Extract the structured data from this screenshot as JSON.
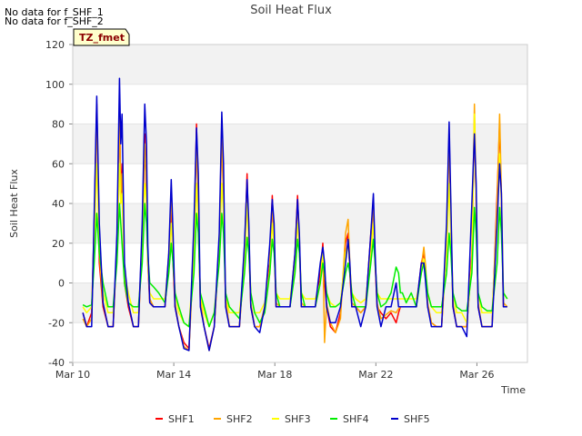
{
  "notices": [
    "No data for f_SHF_1",
    "No data for f_SHF_2"
  ],
  "tz_badge": "TZ_fmet",
  "chart_data": {
    "type": "line",
    "title": "Soil Heat Flux",
    "xlabel": "Time",
    "ylabel": "Soil Heat Flux",
    "ylim": [
      -40,
      120
    ],
    "yticks": [
      -40,
      -20,
      0,
      20,
      40,
      60,
      80,
      100,
      120
    ],
    "xlim": [
      "Mar 10",
      "Mar 28"
    ],
    "xticks": [
      "Mar 10",
      "Mar 14",
      "Mar 18",
      "Mar 22",
      "Mar 26"
    ],
    "grid": "horizontal bands",
    "legend_position": "bottom",
    "series": [
      {
        "name": "SHF1",
        "color": "#ff0000",
        "x": [
          10.4,
          10.55,
          10.75,
          10.85,
          10.95,
          11.05,
          11.2,
          11.4,
          11.6,
          11.75,
          11.85,
          11.9,
          11.95,
          12.05,
          12.2,
          12.4,
          12.6,
          12.75,
          12.85,
          12.92,
          12.97,
          13.05,
          13.2,
          13.4,
          13.65,
          13.8,
          13.9,
          13.97,
          14.05,
          14.2,
          14.4,
          14.6,
          14.8,
          14.9,
          14.97,
          15.05,
          15.2,
          15.4,
          15.6,
          15.8,
          15.9,
          15.97,
          16.05,
          16.2,
          16.4,
          16.6,
          16.8,
          16.9,
          16.97,
          17.05,
          17.2,
          17.4,
          17.6,
          17.8,
          17.9,
          17.97,
          18.05,
          18.2,
          18.4,
          18.6,
          18.8,
          18.9,
          18.97,
          19.05,
          19.2,
          19.4,
          19.6,
          19.8,
          19.9,
          19.97,
          20.05,
          20.2,
          20.4,
          20.6,
          20.8,
          20.9,
          20.97,
          21.05,
          21.2,
          21.4,
          21.6,
          21.8,
          21.9,
          21.97,
          22.05,
          22.2,
          22.4,
          22.6,
          22.8,
          22.9,
          22.97,
          23.05,
          23.2,
          23.4,
          23.6,
          23.8,
          23.9,
          23.97,
          24.05,
          24.2,
          24.4,
          24.6,
          24.8,
          24.9,
          24.97,
          25.05,
          25.2,
          25.4,
          25.6,
          25.8,
          25.9,
          25.97,
          26.05,
          26.2,
          26.4,
          26.6,
          26.8,
          26.9,
          26.97,
          27.05,
          27.2
        ],
        "y": [
          -15,
          -22,
          -15,
          30,
          90,
          10,
          -12,
          -22,
          -22,
          20,
          90,
          40,
          60,
          0,
          -12,
          -22,
          -22,
          25,
          75,
          40,
          10,
          -10,
          -12,
          -12,
          -12,
          12,
          40,
          10,
          -12,
          -22,
          -30,
          -33,
          20,
          80,
          30,
          -10,
          -22,
          -33,
          -22,
          20,
          80,
          40,
          -10,
          -22,
          -22,
          -22,
          15,
          55,
          20,
          -12,
          -22,
          -22,
          -12,
          10,
          44,
          20,
          -12,
          -12,
          -12,
          -12,
          15,
          44,
          20,
          -12,
          -12,
          -12,
          -12,
          5,
          20,
          0,
          -12,
          -22,
          -25,
          -15,
          20,
          25,
          5,
          -12,
          -12,
          -15,
          -12,
          25,
          40,
          10,
          -12,
          -15,
          -18,
          -15,
          -20,
          -15,
          -12,
          -12,
          -12,
          -12,
          -12,
          10,
          15,
          5,
          -12,
          -20,
          -22,
          -22,
          20,
          75,
          30,
          -12,
          -22,
          -22,
          -22,
          15,
          80,
          40,
          -12,
          -22,
          -22,
          -22,
          45,
          80,
          40,
          -12,
          -12
        ]
      },
      {
        "name": "SHF2",
        "color": "#ffa500",
        "x": [
          10.4,
          10.55,
          10.75,
          10.85,
          10.95,
          11.05,
          11.2,
          11.4,
          11.6,
          11.75,
          11.85,
          11.9,
          11.95,
          12.05,
          12.2,
          12.4,
          12.6,
          12.75,
          12.85,
          12.92,
          12.97,
          13.05,
          13.2,
          13.4,
          13.65,
          13.8,
          13.9,
          13.97,
          14.05,
          14.2,
          14.4,
          14.6,
          14.8,
          14.9,
          14.97,
          15.05,
          15.2,
          15.4,
          15.6,
          15.8,
          15.9,
          15.97,
          16.05,
          16.2,
          16.4,
          16.6,
          16.8,
          16.9,
          16.97,
          17.05,
          17.2,
          17.4,
          17.6,
          17.8,
          17.9,
          17.97,
          18.05,
          18.2,
          18.4,
          18.6,
          18.8,
          18.9,
          18.97,
          19.05,
          19.2,
          19.4,
          19.6,
          19.8,
          19.9,
          19.97,
          20.05,
          20.2,
          20.4,
          20.6,
          20.8,
          20.9,
          20.97,
          21.05,
          21.2,
          21.4,
          21.6,
          21.8,
          21.9,
          21.97,
          22.05,
          22.2,
          22.4,
          22.6,
          22.8,
          22.9,
          22.97,
          23.05,
          23.2,
          23.4,
          23.6,
          23.8,
          23.9,
          23.97,
          24.05,
          24.2,
          24.4,
          24.6,
          24.8,
          24.9,
          24.97,
          25.05,
          25.2,
          25.4,
          25.6,
          25.8,
          25.9,
          25.97,
          26.05,
          26.2,
          26.4,
          26.6,
          26.8,
          26.9,
          26.97,
          27.05,
          27.2
        ],
        "y": [
          -18,
          -22,
          -18,
          25,
          85,
          15,
          -10,
          -22,
          -22,
          18,
          85,
          45,
          55,
          5,
          -10,
          -22,
          -22,
          22,
          70,
          45,
          12,
          -8,
          -12,
          -12,
          -12,
          15,
          45,
          15,
          -10,
          -22,
          -32,
          -34,
          18,
          75,
          35,
          -8,
          -22,
          -34,
          -22,
          18,
          75,
          40,
          -8,
          -22,
          -22,
          -22,
          12,
          50,
          25,
          -10,
          -22,
          -22,
          -12,
          8,
          40,
          25,
          -10,
          -12,
          -12,
          -12,
          12,
          40,
          22,
          -10,
          -12,
          -12,
          -12,
          0,
          18,
          -30,
          -10,
          -20,
          -25,
          -18,
          25,
          32,
          10,
          -10,
          -12,
          -15,
          -12,
          22,
          38,
          12,
          -10,
          -18,
          -16,
          -14,
          -15,
          -13,
          -12,
          -12,
          -12,
          -12,
          -12,
          8,
          18,
          8,
          -10,
          -20,
          -22,
          -22,
          18,
          70,
          35,
          -10,
          -22,
          -22,
          -22,
          12,
          90,
          45,
          -10,
          -22,
          -22,
          -22,
          40,
          85,
          45,
          -10,
          -12
        ]
      },
      {
        "name": "SHF3",
        "color": "#ffff00",
        "x": [
          10.4,
          10.55,
          10.75,
          10.85,
          10.95,
          11.05,
          11.2,
          11.4,
          11.6,
          11.75,
          11.85,
          11.9,
          11.95,
          12.05,
          12.2,
          12.4,
          12.6,
          12.75,
          12.85,
          12.92,
          12.97,
          13.05,
          13.2,
          13.4,
          13.65,
          13.8,
          13.9,
          13.97,
          14.05,
          14.2,
          14.4,
          14.6,
          14.8,
          14.9,
          14.97,
          15.05,
          15.2,
          15.4,
          15.6,
          15.8,
          15.9,
          15.97,
          16.05,
          16.2,
          16.4,
          16.6,
          16.8,
          16.9,
          16.97,
          17.05,
          17.2,
          17.4,
          17.6,
          17.8,
          17.9,
          17.97,
          18.05,
          18.2,
          18.4,
          18.6,
          18.8,
          18.9,
          18.97,
          19.05,
          19.2,
          19.4,
          19.6,
          19.8,
          19.9,
          19.97,
          20.05,
          20.2,
          20.4,
          20.6,
          20.8,
          20.9,
          20.97,
          21.05,
          21.2,
          21.4,
          21.6,
          21.8,
          21.9,
          21.97,
          22.05,
          22.2,
          22.4,
          22.6,
          22.8,
          22.9,
          22.97,
          23.05,
          23.2,
          23.4,
          23.6,
          23.8,
          23.9,
          23.97,
          24.05,
          24.2,
          24.4,
          24.6,
          24.8,
          24.9,
          24.97,
          25.05,
          25.2,
          25.4,
          25.6,
          25.8,
          25.9,
          25.97,
          26.05,
          26.2,
          26.4,
          26.6,
          26.8,
          26.9,
          26.97,
          27.05,
          27.2
        ],
        "y": [
          -12,
          -15,
          -12,
          20,
          60,
          20,
          -5,
          -15,
          -15,
          15,
          60,
          40,
          45,
          5,
          -5,
          -15,
          -15,
          18,
          50,
          40,
          10,
          -5,
          -8,
          -8,
          -8,
          10,
          30,
          15,
          -5,
          -15,
          -20,
          -22,
          15,
          50,
          30,
          -5,
          -15,
          -22,
          -15,
          15,
          50,
          35,
          -5,
          -15,
          -15,
          -15,
          10,
          40,
          20,
          -5,
          -15,
          -15,
          -10,
          5,
          30,
          20,
          -5,
          -8,
          -8,
          -8,
          10,
          30,
          18,
          -5,
          -8,
          -8,
          -8,
          0,
          15,
          5,
          -5,
          -10,
          -12,
          -10,
          15,
          20,
          8,
          -5,
          -8,
          -10,
          -8,
          15,
          30,
          10,
          -5,
          -8,
          -8,
          -8,
          -8,
          -8,
          -8,
          -8,
          -8,
          -8,
          -8,
          5,
          12,
          5,
          -5,
          -12,
          -15,
          -15,
          15,
          50,
          25,
          -5,
          -15,
          -15,
          -20,
          10,
          85,
          40,
          -5,
          -15,
          -15,
          -15,
          30,
          65,
          40,
          -5,
          -8
        ]
      },
      {
        "name": "SHF4",
        "color": "#00ee00",
        "x": [
          10.4,
          10.55,
          10.75,
          10.85,
          10.95,
          11.05,
          11.2,
          11.4,
          11.6,
          11.75,
          11.85,
          11.9,
          11.95,
          12.05,
          12.2,
          12.4,
          12.6,
          12.75,
          12.85,
          12.92,
          12.97,
          13.05,
          13.2,
          13.4,
          13.65,
          13.8,
          13.9,
          13.97,
          14.05,
          14.2,
          14.4,
          14.6,
          14.8,
          14.9,
          14.97,
          15.05,
          15.2,
          15.4,
          15.6,
          15.8,
          15.9,
          15.97,
          16.05,
          16.2,
          16.4,
          16.6,
          16.8,
          16.9,
          16.97,
          17.05,
          17.2,
          17.4,
          17.6,
          17.8,
          17.9,
          17.97,
          18.05,
          18.2,
          18.4,
          18.6,
          18.8,
          18.9,
          18.97,
          19.05,
          19.2,
          19.4,
          19.6,
          19.8,
          19.9,
          19.97,
          20.05,
          20.2,
          20.4,
          20.6,
          20.8,
          20.9,
          20.97,
          21.05,
          21.2,
          21.4,
          21.6,
          21.8,
          21.9,
          21.97,
          22.05,
          22.2,
          22.4,
          22.6,
          22.8,
          22.9,
          22.97,
          23.05,
          23.2,
          23.4,
          23.6,
          23.8,
          23.9,
          23.97,
          24.05,
          24.2,
          24.4,
          24.6,
          24.8,
          24.9,
          24.97,
          25.05,
          25.2,
          25.4,
          25.6,
          25.8,
          25.9,
          25.97,
          26.05,
          26.2,
          26.4,
          26.6,
          26.8,
          26.9,
          26.97,
          27.05,
          27.2
        ],
        "y": [
          -11,
          -12,
          -11,
          10,
          35,
          15,
          0,
          -12,
          -12,
          10,
          40,
          30,
          20,
          0,
          -10,
          -12,
          -12,
          10,
          40,
          30,
          15,
          0,
          -2,
          -5,
          -10,
          5,
          20,
          10,
          -5,
          -12,
          -20,
          -22,
          5,
          35,
          25,
          -5,
          -12,
          -22,
          -15,
          10,
          35,
          25,
          -5,
          -12,
          -15,
          -18,
          5,
          23,
          15,
          -5,
          -15,
          -20,
          -15,
          5,
          22,
          15,
          -5,
          -12,
          -12,
          -12,
          5,
          22,
          15,
          -5,
          -12,
          -12,
          -12,
          0,
          10,
          5,
          -5,
          -12,
          -12,
          -10,
          5,
          10,
          5,
          -5,
          -12,
          -12,
          -12,
          10,
          22,
          10,
          -5,
          -12,
          -10,
          -5,
          8,
          5,
          -5,
          -5,
          -10,
          -5,
          -12,
          5,
          10,
          5,
          -5,
          -12,
          -12,
          -12,
          5,
          25,
          15,
          -5,
          -12,
          -14,
          -14,
          5,
          38,
          25,
          -5,
          -12,
          -14,
          -14,
          10,
          38,
          25,
          -5,
          -8
        ]
      },
      {
        "name": "SHF5",
        "color": "#0000cc",
        "x": [
          10.4,
          10.55,
          10.75,
          10.85,
          10.95,
          11.05,
          11.2,
          11.4,
          11.6,
          11.75,
          11.85,
          11.9,
          11.95,
          12.05,
          12.2,
          12.4,
          12.6,
          12.75,
          12.85,
          12.92,
          12.97,
          13.05,
          13.2,
          13.4,
          13.65,
          13.8,
          13.9,
          13.97,
          14.05,
          14.2,
          14.4,
          14.6,
          14.8,
          14.9,
          14.97,
          15.05,
          15.2,
          15.4,
          15.6,
          15.8,
          15.9,
          15.97,
          16.05,
          16.2,
          16.4,
          16.6,
          16.8,
          16.9,
          16.97,
          17.05,
          17.2,
          17.4,
          17.6,
          17.8,
          17.9,
          17.97,
          18.05,
          18.2,
          18.4,
          18.6,
          18.8,
          18.9,
          18.97,
          19.05,
          19.2,
          19.4,
          19.6,
          19.8,
          19.9,
          19.97,
          20.05,
          20.2,
          20.4,
          20.6,
          20.8,
          20.9,
          20.97,
          21.05,
          21.2,
          21.4,
          21.6,
          21.8,
          21.9,
          21.97,
          22.05,
          22.2,
          22.4,
          22.6,
          22.8,
          22.9,
          22.97,
          23.05,
          23.2,
          23.4,
          23.6,
          23.8,
          23.9,
          23.97,
          24.05,
          24.2,
          24.4,
          24.6,
          24.8,
          24.9,
          24.97,
          25.05,
          25.2,
          25.4,
          25.6,
          25.8,
          25.9,
          25.97,
          26.05,
          26.2,
          26.4,
          26.6,
          26.8,
          26.9,
          26.97,
          27.05,
          27.2
        ],
        "y": [
          -15,
          -22,
          -22,
          35,
          94,
          30,
          -10,
          -22,
          -22,
          25,
          103,
          70,
          85,
          10,
          -10,
          -22,
          -22,
          30,
          90,
          70,
          20,
          -10,
          -12,
          -12,
          -12,
          15,
          52,
          25,
          -12,
          -22,
          -33,
          -34,
          30,
          78,
          55,
          -12,
          -22,
          -34,
          -22,
          25,
          86,
          60,
          -12,
          -22,
          -22,
          -22,
          20,
          52,
          30,
          -12,
          -22,
          -25,
          -12,
          20,
          42,
          30,
          -12,
          -12,
          -12,
          -12,
          15,
          42,
          25,
          -12,
          -12,
          -12,
          -12,
          10,
          18,
          10,
          -12,
          -20,
          -20,
          -12,
          10,
          22,
          10,
          -12,
          -12,
          -22,
          -12,
          25,
          45,
          15,
          -12,
          -22,
          -12,
          -12,
          0,
          -12,
          -12,
          -12,
          -12,
          -12,
          -12,
          10,
          10,
          0,
          -12,
          -22,
          -22,
          -22,
          30,
          81,
          40,
          -12,
          -22,
          -22,
          -27,
          40,
          75,
          50,
          -12,
          -22,
          -22,
          -22,
          30,
          60,
          45,
          -12,
          -12
        ]
      }
    ]
  }
}
